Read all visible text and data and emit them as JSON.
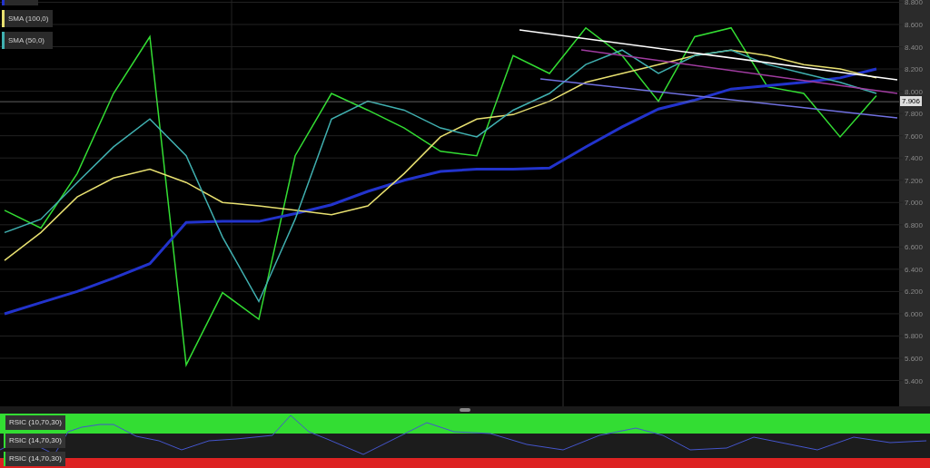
{
  "price_tag": "7.906",
  "chart_data": {
    "type": "line",
    "grid": true,
    "ylim": [
      5380,
      8820
    ],
    "yticks": [
      {
        "value": 8800,
        "label": "8.800"
      },
      {
        "value": 8600,
        "label": "8.600"
      },
      {
        "value": 8400,
        "label": "8.400"
      },
      {
        "value": 8200,
        "label": "8.200"
      },
      {
        "value": 8000,
        "label": "8.000"
      },
      {
        "value": 7800,
        "label": "7.800"
      },
      {
        "value": 7600,
        "label": "7.600"
      },
      {
        "value": 7400,
        "label": "7.400"
      },
      {
        "value": 7200,
        "label": "7.200"
      },
      {
        "value": 7000,
        "label": "7.000"
      },
      {
        "value": 6800,
        "label": "6.800"
      },
      {
        "value": 6600,
        "label": "6.600"
      },
      {
        "value": 6400,
        "label": "6.400"
      },
      {
        "value": 6200,
        "label": "6.200"
      },
      {
        "value": 6000,
        "label": "6.000"
      },
      {
        "value": 5800,
        "label": "5.800"
      },
      {
        "value": 5600,
        "label": "5.600"
      },
      {
        "value": 5400,
        "label": "5.400"
      }
    ],
    "series": [
      {
        "color": "#33dd33",
        "values": [
          6930,
          6770,
          7260,
          7980,
          8490,
          5540,
          6190,
          5950,
          7420,
          7980,
          7830,
          7670,
          7460,
          7420,
          8320,
          8160,
          8570,
          8320,
          7910,
          8490,
          8570,
          8040,
          7980,
          7590,
          7960
        ]
      },
      {
        "color": "#2233cc",
        "values": [
          6000,
          6100,
          6200,
          6320,
          6450,
          6820,
          6830,
          6830,
          6900,
          6980,
          7100,
          7200,
          7280,
          7300,
          7300,
          7310,
          7500,
          7680,
          7840,
          7920,
          8020,
          8050,
          8080,
          8120,
          8200
        ]
      },
      {
        "name": "SMA (100,0)",
        "color": "#e8e070",
        "values": [
          6480,
          6730,
          7050,
          7220,
          7300,
          7180,
          7000,
          6970,
          6930,
          6890,
          6970,
          7260,
          7590,
          7750,
          7790,
          7910,
          8080,
          8160,
          8240,
          8320,
          8370,
          8320,
          8240,
          8200,
          8120
        ]
      },
      {
        "name": "SMA (50,0)",
        "color": "#40b0b0",
        "values": [
          6730,
          6850,
          7180,
          7500,
          7750,
          7420,
          6690,
          6110,
          6850,
          7750,
          7910,
          7830,
          7670,
          7590,
          7830,
          7980,
          8240,
          8370,
          8160,
          8320,
          8370,
          8240,
          8160,
          8080,
          7980
        ]
      }
    ],
    "orientation": "vertical"
  },
  "rsi_labels": [
    "RSIC (10,70,30)",
    "RSIC (14,70,30)",
    "RSIC (14,70,30)"
  ]
}
